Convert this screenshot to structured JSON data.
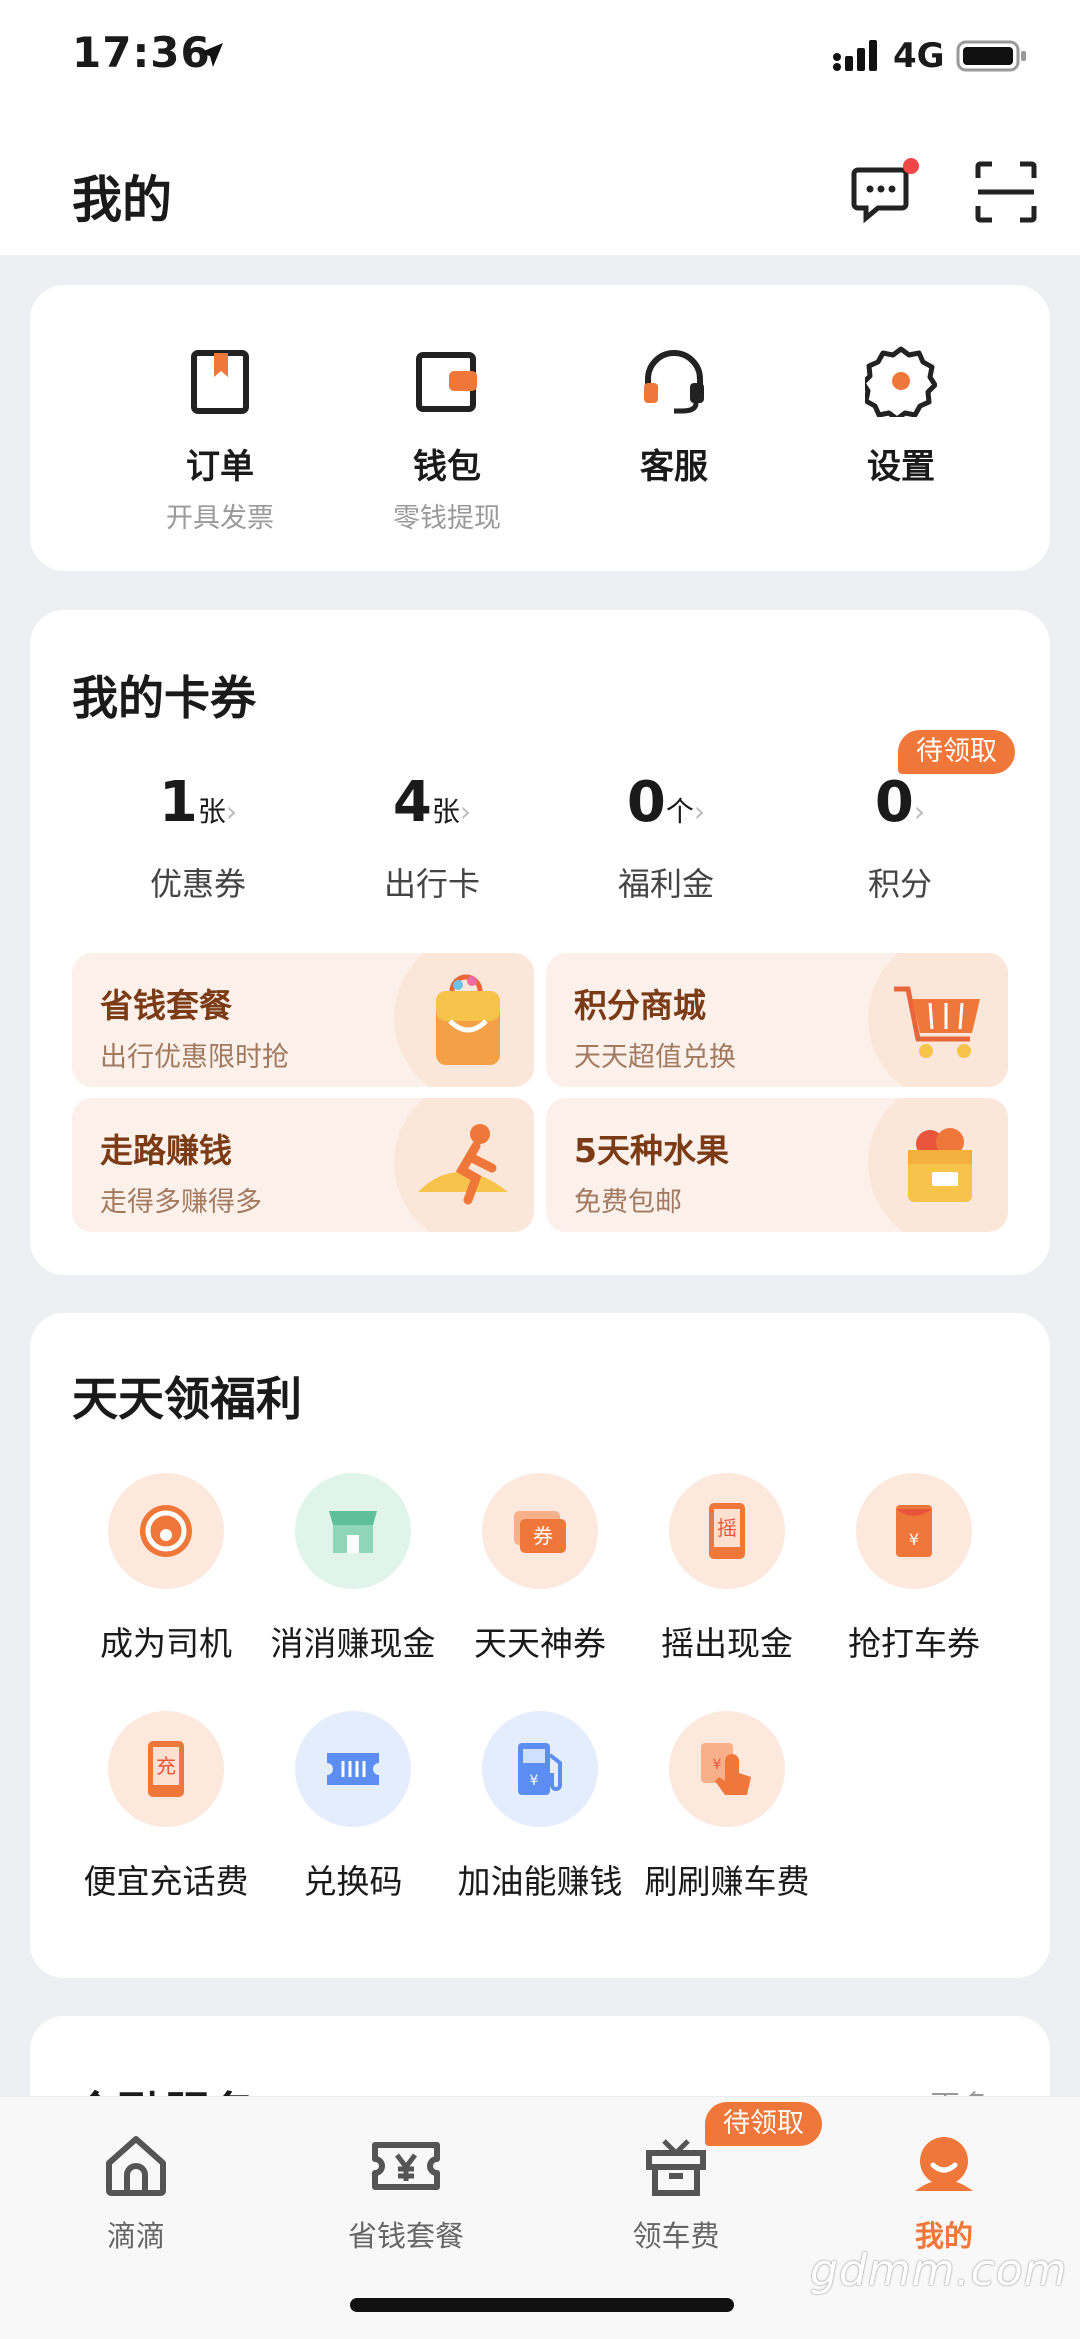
{
  "status_bar": {
    "time": "17:36",
    "network": "4G"
  },
  "header": {
    "title": "我的"
  },
  "quick_actions": [
    {
      "label": "订单",
      "sub": "开具发票",
      "icon": "order-icon"
    },
    {
      "label": "钱包",
      "sub": "零钱提现",
      "icon": "wallet-icon"
    },
    {
      "label": "客服",
      "sub": "",
      "icon": "headset-icon"
    },
    {
      "label": "设置",
      "sub": "",
      "icon": "gear-icon"
    }
  ],
  "cards_section": {
    "title": "我的卡券",
    "pending_badge": "待领取",
    "items": [
      {
        "value": "1",
        "unit": "张",
        "label": "优惠券"
      },
      {
        "value": "4",
        "unit": "张",
        "label": "出行卡"
      },
      {
        "value": "0",
        "unit": "个",
        "label": "福利金"
      },
      {
        "value": "0",
        "unit": "",
        "label": "积分"
      }
    ],
    "promos": [
      {
        "title": "省钱套餐",
        "sub": "出行优惠限时抢",
        "icon": "shopping-bag-icon"
      },
      {
        "title": "积分商城",
        "sub": "天天超值兑换",
        "icon": "shopping-cart-icon"
      },
      {
        "title": "走路赚钱",
        "sub": "走得多赚得多",
        "icon": "walking-figure-icon"
      },
      {
        "title": "5天种水果",
        "sub": "免费包邮",
        "icon": "fruit-box-icon"
      }
    ]
  },
  "welfare_section": {
    "title": "天天领福利",
    "items": [
      {
        "label": "成为司机",
        "icon": "steering-wheel-icon"
      },
      {
        "label": "消消赚现金",
        "icon": "game-store-icon"
      },
      {
        "label": "天天神券",
        "icon": "coupon-ticket-icon"
      },
      {
        "label": "摇出现金",
        "icon": "shake-phone-icon"
      },
      {
        "label": "抢打车券",
        "icon": "red-envelope-icon"
      },
      {
        "label": "便宜充话费",
        "icon": "phone-topup-icon"
      },
      {
        "label": "兑换码",
        "icon": "redeem-code-icon"
      },
      {
        "label": "加油能赚钱",
        "icon": "fuel-pump-icon"
      },
      {
        "label": "刷刷赚车费",
        "icon": "tap-hand-icon"
      }
    ]
  },
  "finance_section": {
    "title": "金融服务",
    "more": "更多"
  },
  "tab_bar": {
    "badge": "待领取",
    "tabs": [
      {
        "label": "滴滴",
        "icon": "home-icon"
      },
      {
        "label": "省钱套餐",
        "icon": "yuan-ticket-icon"
      },
      {
        "label": "领车费",
        "icon": "gift-icon"
      },
      {
        "label": "我的",
        "icon": "profile-avatar-icon"
      }
    ]
  },
  "watermark": "gdmm.com",
  "colors": {
    "accent": "#f0773a",
    "promo_bg": "#fcf1ea",
    "page_bg": "#eeeff3"
  }
}
